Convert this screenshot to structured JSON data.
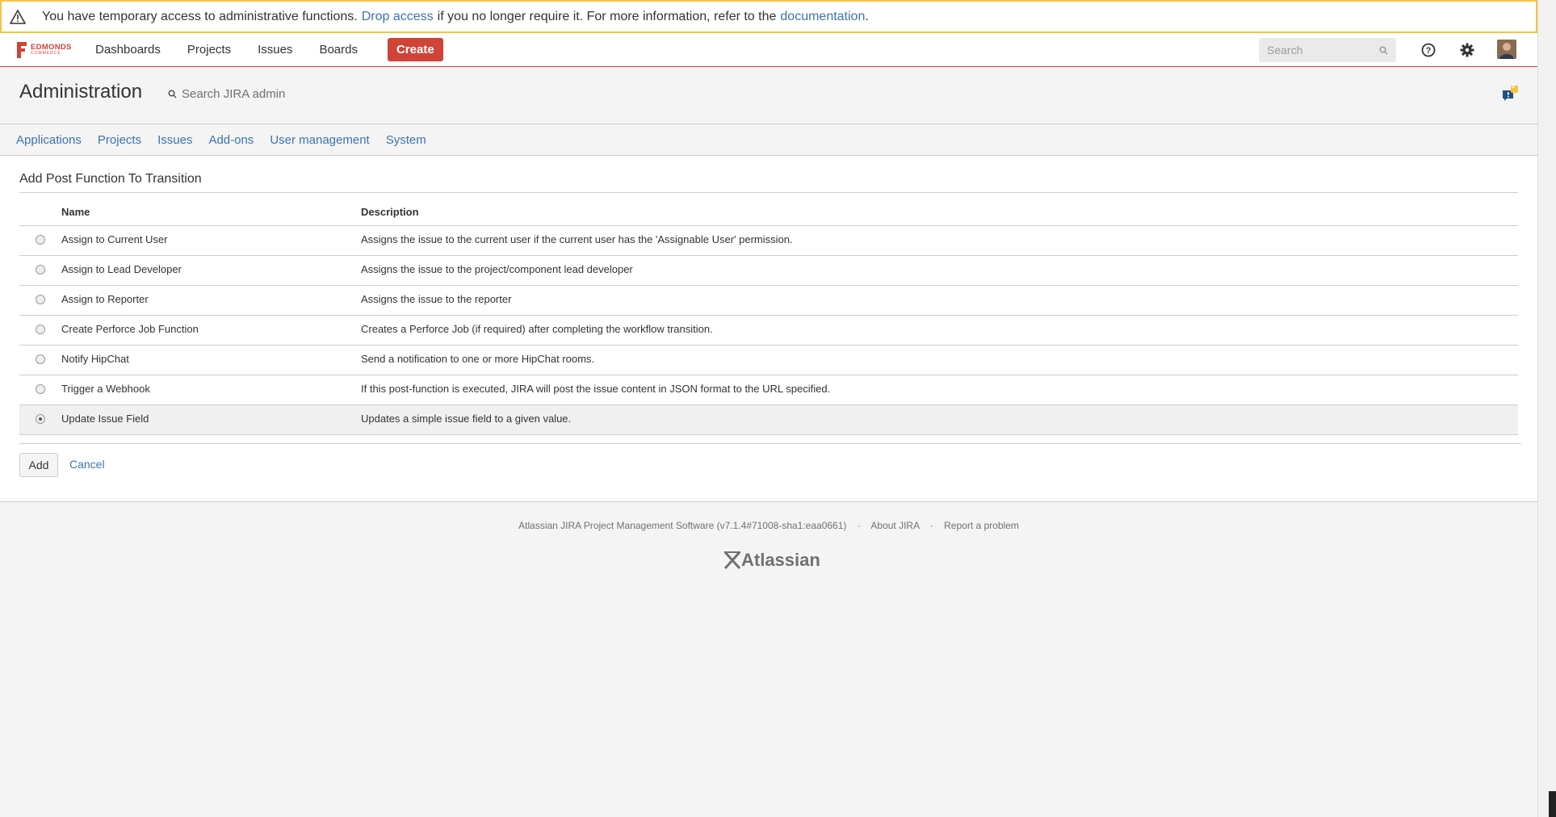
{
  "banner": {
    "text_before": "You have temporary access to administrative functions.",
    "drop_link": "Drop access",
    "text_middle": "if you no longer require it. For more information, refer to the",
    "doc_link": "documentation",
    "text_after": "."
  },
  "header": {
    "logo_text": "EDMONDS",
    "logo_sub": "COMMERCE",
    "nav": [
      "Dashboards",
      "Projects",
      "Issues",
      "Boards"
    ],
    "create_label": "Create",
    "search_placeholder": "Search"
  },
  "admin": {
    "title": "Administration",
    "search_placeholder": "Search JIRA admin",
    "notification_count": "1",
    "tabs": [
      "Applications",
      "Projects",
      "Issues",
      "Add-ons",
      "User management",
      "System"
    ]
  },
  "content": {
    "section_title": "Add Post Function To Transition",
    "columns": {
      "name": "Name",
      "description": "Description"
    },
    "rows": [
      {
        "name": "Assign to Current User",
        "description": "Assigns the issue to the current user if the current user has the 'Assignable User' permission."
      },
      {
        "name": "Assign to Lead Developer",
        "description": "Assigns the issue to the project/component lead developer"
      },
      {
        "name": "Assign to Reporter",
        "description": "Assigns the issue to the reporter"
      },
      {
        "name": "Create Perforce Job Function",
        "description": "Creates a Perforce Job (if required) after completing the workflow transition."
      },
      {
        "name": "Notify HipChat",
        "description": "Send a notification to one or more HipChat rooms."
      },
      {
        "name": "Trigger a Webhook",
        "description": "If this post-function is executed, JIRA will post the issue content in JSON format to the URL specified."
      },
      {
        "name": "Update Issue Field",
        "description": "Updates a simple issue field to a given value."
      }
    ],
    "selected_row": "Update Issue Field",
    "add_label": "Add",
    "cancel_label": "Cancel"
  },
  "footer": {
    "version": "Atlassian JIRA Project Management Software (v7.1.4#71008-sha1:eaa0661)",
    "about": "About JIRA",
    "report": "Report a problem",
    "brand": "Atlassian"
  },
  "colors": {
    "accent": "#d04437",
    "link": "#3b73af",
    "warning": "#f6c342"
  }
}
